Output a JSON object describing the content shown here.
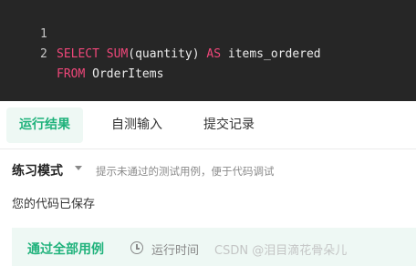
{
  "editor": {
    "lines": [
      {
        "number": "1",
        "keyword1": "SELECT",
        "space1": " ",
        "function": "SUM",
        "args": "(quantity)",
        "space2": " ",
        "keyword2": "AS",
        "rest": " items_ordered"
      },
      {
        "number": "2",
        "keyword1": "FROM",
        "rest": " OrderItems"
      }
    ]
  },
  "tabs": [
    {
      "label": "运行结果",
      "active": true
    },
    {
      "label": "自测输入",
      "active": false
    },
    {
      "label": "提交记录",
      "active": false
    }
  ],
  "mode": {
    "label": "练习模式",
    "hint": "提示未通过的测试用例，便于代码调试"
  },
  "status": {
    "saved": "您的代码已保存"
  },
  "result": {
    "pass_label": "通过全部用例",
    "runtime_label": "运行时间",
    "watermark": "CSDN @泪目滴花骨朵儿"
  },
  "colors": {
    "editor_bg": "#262626",
    "keyword": "#f0477a",
    "accent_green": "#1fb27b",
    "active_tab_bg": "#eef8f4"
  }
}
